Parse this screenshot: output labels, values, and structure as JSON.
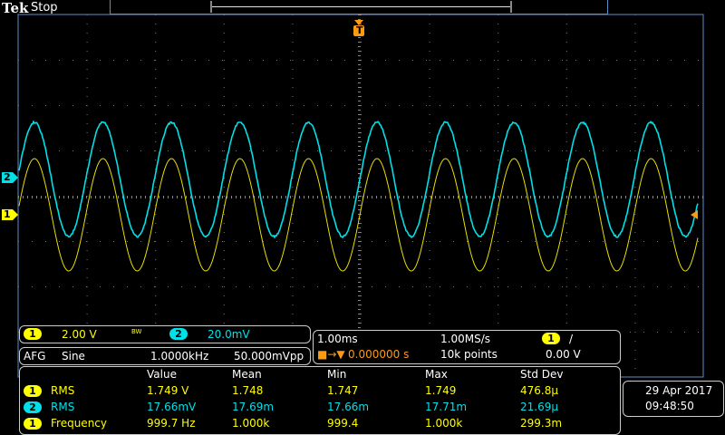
{
  "header": {
    "logo": "Tek",
    "status": "Stop"
  },
  "colors": {
    "ch1": "#ffff00",
    "ch2": "#00e0e8",
    "trigger": "#ff9a10",
    "frame": "#5b8ec8"
  },
  "markers": {
    "ch1": "1",
    "ch2": "2",
    "trigger": "T"
  },
  "vertical": {
    "ch1_scale": "2.00 V",
    "bw": "BW",
    "ch2_scale": "20.0mV"
  },
  "afg": {
    "label": "AFG",
    "wave": "Sine",
    "freq": "1.0000kHz",
    "amplitude": "50.000mVpp"
  },
  "horizontal": {
    "timebase": "1.00ms",
    "sample_rate": "1.00MS/s",
    "trigger_pos": "0.000000 s",
    "record": "10k points",
    "trigger_source": "1",
    "trigger_slope": "/",
    "trigger_level": "0.00 V"
  },
  "measurements": {
    "headers": [
      "Value",
      "Mean",
      "Min",
      "Max",
      "Std Dev"
    ],
    "rows": [
      {
        "ch": "1",
        "name": "RMS",
        "values": [
          "1.749 V",
          "1.748",
          "1.747",
          "1.749",
          "476.8µ"
        ]
      },
      {
        "ch": "2",
        "name": "RMS",
        "values": [
          "17.66mV",
          "17.69m",
          "17.66m",
          "17.71m",
          "21.69µ"
        ]
      },
      {
        "ch": "1",
        "name": "Frequency",
        "values": [
          "999.7 Hz",
          "1.000k",
          "999.4",
          "1.000k",
          "299.3m"
        ]
      }
    ]
  },
  "datetime": {
    "date": "29 Apr  2017",
    "time": "09:48:50"
  }
}
